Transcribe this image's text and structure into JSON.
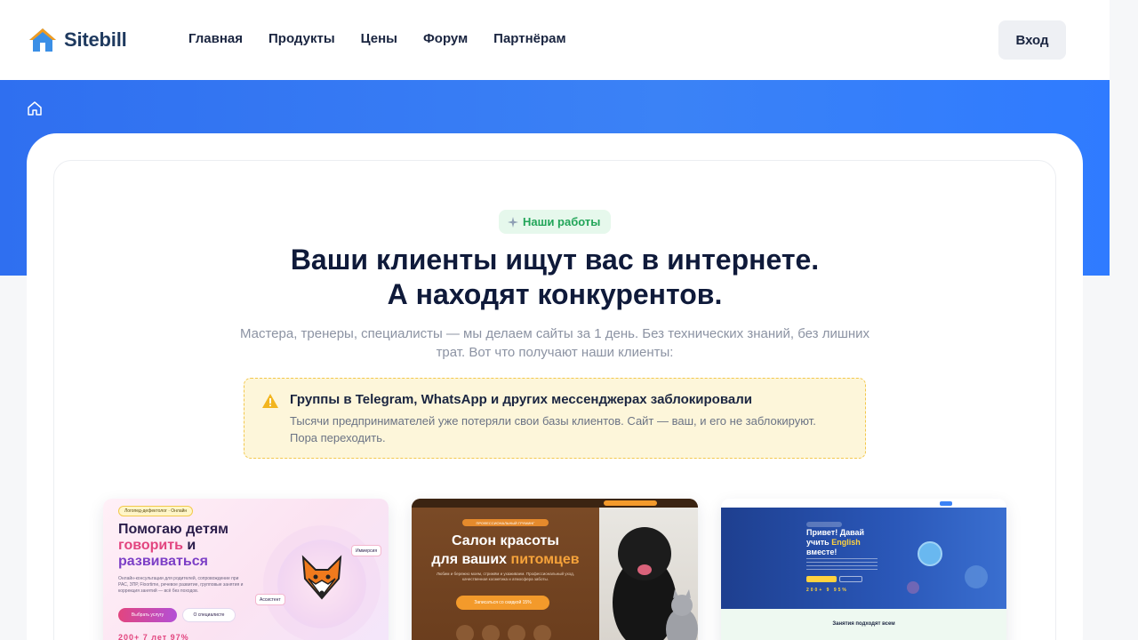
{
  "header": {
    "logo_text": "Sitebill",
    "nav": [
      "Главная",
      "Продукты",
      "Цены",
      "Форум",
      "Партнёрам"
    ],
    "login_label": "Вход"
  },
  "hero": {
    "badge": "Наши работы",
    "title_line1": "Ваши клиенты ищут вас в интернете.",
    "title_line2": "А находят конкурентов.",
    "subtitle": "Мастера, тренеры, специалисты — мы делаем сайты за 1 день. Без технических знаний, без лишних трат. Вот что получают наши клиенты:"
  },
  "alert": {
    "title": "Группы в Telegram, WhatsApp и других мессенджерах заблокировали",
    "text": "Тысячи предпринимателей уже потеряли свои базы клиентов. Сайт — ваш, и его не заблокируют. Пора переходить."
  },
  "showcase": [
    {
      "pill": "Логопед-дефектолог · Онлайн",
      "title_a": "Помогаю детям",
      "title_b": "говорить",
      "title_c": "и",
      "title_d": "развиваться",
      "text": "Онлайн-консультации для родителей, сопровождение при РАС, ЗПР, Floortime, речевое развитие, групповые занятия и коррекция занятий — всё без походов.",
      "btn_primary": "Выбрать услугу",
      "btn_secondary": "О специалисте",
      "stats": "200+  7 лет  97%",
      "chip1": "Иммерсия",
      "chip2": "Ассистент"
    },
    {
      "pill": "ПРОФЕССИОНАЛЬНЫЙ ГРУМИНГ",
      "title_a": "Салон красоты",
      "title_b": "для ваших",
      "title_c": "питомцев",
      "text": "Любим и бережно моем, стрижём и ухаживаем. Профессиональный уход, качественная косметика и атмосфера заботы.",
      "btn": "Записаться со скидкой 15%"
    },
    {
      "title_a": "Привет! Давай",
      "title_b": "учить",
      "title_c": "English",
      "title_d": "вместе!",
      "stats": "200+  9  95%",
      "section_title": "Занятия подходят всем"
    }
  ],
  "colors": {
    "accent": "#3b82f6",
    "badge_green": "#22a559",
    "alert_bg": "#fdf6da",
    "alert_border": "#f3c74c"
  },
  "icons": {
    "home": "home-icon",
    "sparkle": "sparkle-icon",
    "warning": "warning-icon"
  }
}
